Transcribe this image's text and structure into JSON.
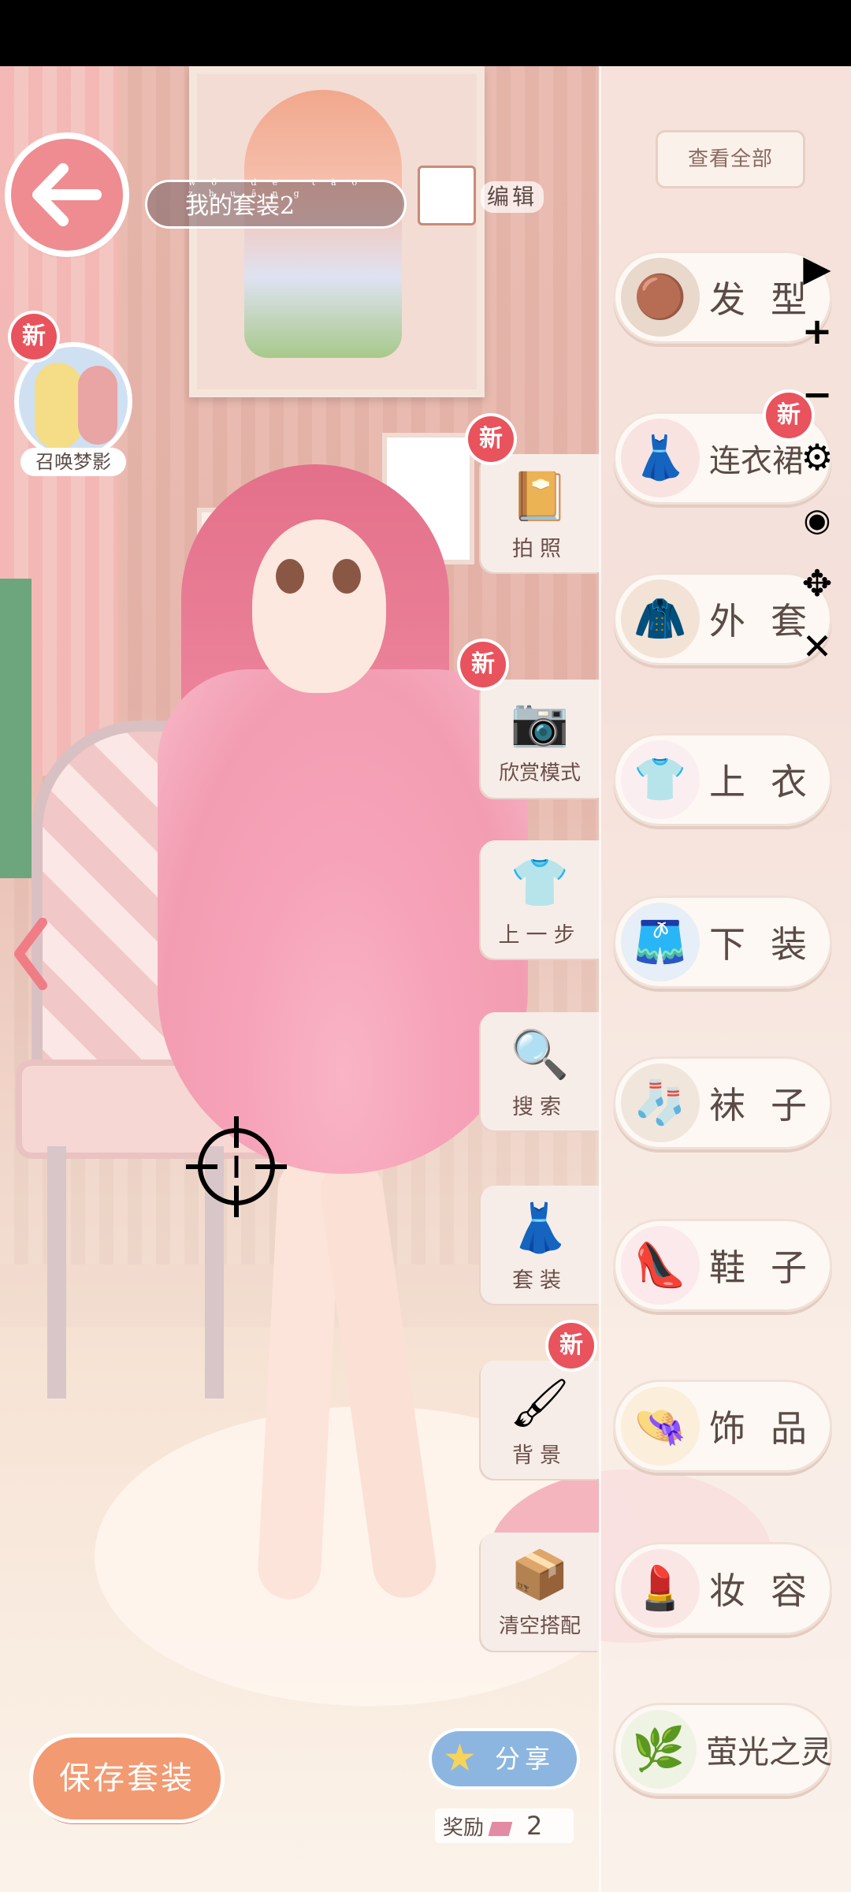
{
  "header": {
    "outfit_name": "我的套装2",
    "outfit_pinyin": "wǒ de tào zhuāng",
    "edit_label": "编辑",
    "view_all_label": "查看全部"
  },
  "summon": {
    "badge": "新",
    "label": "召唤梦影"
  },
  "categories": [
    {
      "label": "发型",
      "icon": "hair-icon",
      "glyph": "🟤"
    },
    {
      "label": "连衣裙",
      "icon": "dress-icon",
      "glyph": "👗",
      "badge": "新"
    },
    {
      "label": "外套",
      "icon": "coat-icon",
      "glyph": "🧥"
    },
    {
      "label": "上衣",
      "icon": "top-icon",
      "glyph": "👕"
    },
    {
      "label": "下装",
      "icon": "shorts-icon",
      "glyph": "🩳"
    },
    {
      "label": "袜子",
      "icon": "socks-icon",
      "glyph": "🧦"
    },
    {
      "label": "鞋子",
      "icon": "shoes-icon",
      "glyph": "👠"
    },
    {
      "label": "饰品",
      "icon": "hat-icon",
      "glyph": "👒"
    },
    {
      "label": "妆容",
      "icon": "compact-icon",
      "glyph": "💄"
    },
    {
      "label": "萤光之灵",
      "icon": "branch-icon",
      "glyph": "🌿"
    }
  ],
  "functions": [
    {
      "label": "拍照",
      "icon": "photo-album-icon",
      "glyph": "📔",
      "badge": "新"
    },
    {
      "label": "欣赏模式",
      "icon": "camera-icon",
      "glyph": "📷",
      "badge": "新"
    },
    {
      "label": "上一步",
      "icon": "undo-icon",
      "glyph": "👕"
    },
    {
      "label": "搜索",
      "icon": "magnifier-icon",
      "glyph": "🔍"
    },
    {
      "label": "套装",
      "icon": "outfit-icon",
      "glyph": "👗"
    },
    {
      "label": "背景",
      "icon": "paintbrush-icon",
      "glyph": "🖌",
      "badge": "新"
    },
    {
      "label": "清空搭配",
      "icon": "clear-box-icon",
      "glyph": "📦"
    }
  ],
  "bottom": {
    "save_label": "保存套装",
    "share_label": "分享",
    "reward_label": "奖励",
    "reward_count": "2"
  },
  "toolbar": {
    "play": "▶",
    "plus": "+",
    "minus": "−",
    "gear": "⚙",
    "eye": "◉",
    "move": "✥",
    "close": "✕"
  },
  "colors": {
    "accent_pink": "#ef8c91",
    "save_orange": "#f29a72",
    "share_blue": "#8cb6df",
    "badge_red": "#e8535d"
  }
}
